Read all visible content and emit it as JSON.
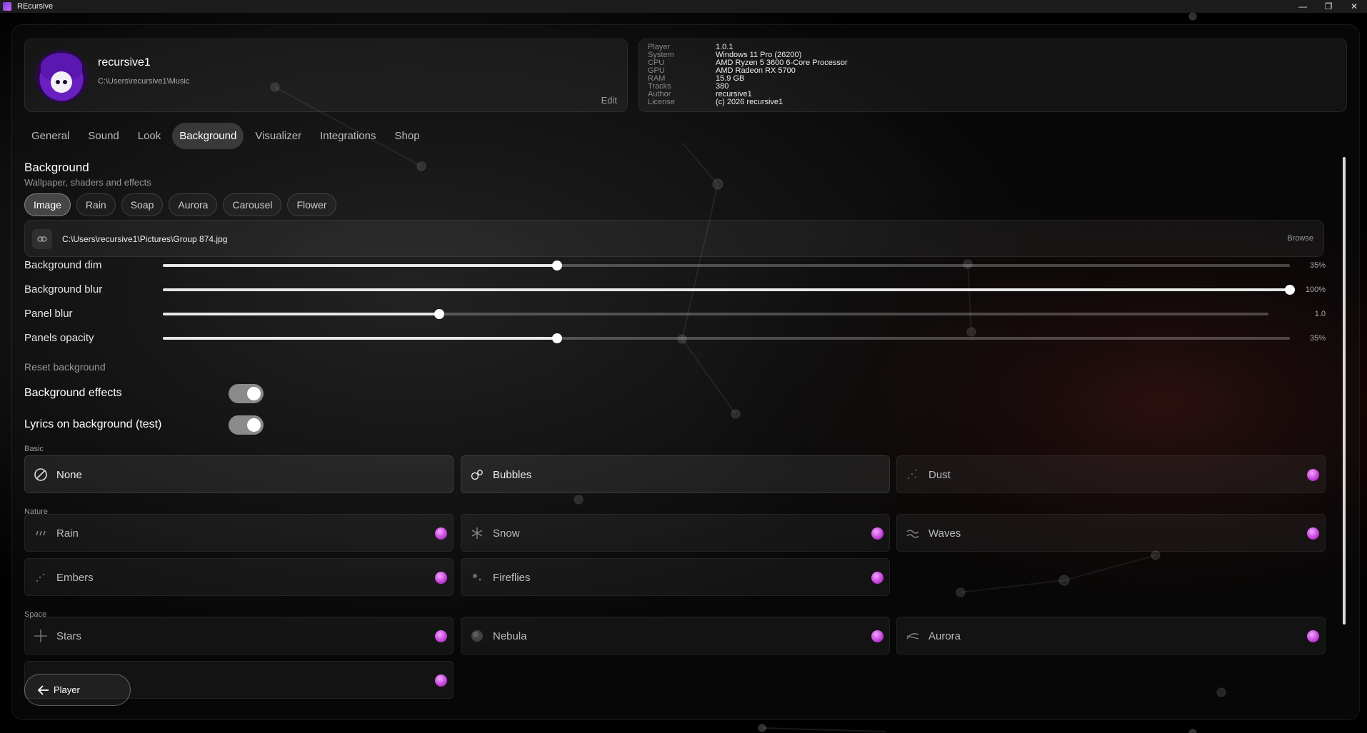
{
  "window": {
    "title": "REcursive",
    "minimize": "—",
    "restore": "❐",
    "close": "✕"
  },
  "profile": {
    "username": "recursive1",
    "music_path": "C:\\Users\\recursive1\\Music",
    "edit_label": "Edit"
  },
  "sysinfo": [
    {
      "key": "Player",
      "value": "1.0.1"
    },
    {
      "key": "System",
      "value": "Windows 11 Pro (26200)"
    },
    {
      "key": "CPU",
      "value": "AMD Ryzen 5 3600 6-Core Processor"
    },
    {
      "key": "GPU",
      "value": "AMD Radeon RX 5700"
    },
    {
      "key": "RAM",
      "value": "15.9 GB"
    },
    {
      "key": "Tracks",
      "value": "380"
    },
    {
      "key": "Author",
      "value": "recursive1"
    },
    {
      "key": "License",
      "value": "(c) 2026 recursive1"
    }
  ],
  "tabs": [
    {
      "label": "General",
      "active": false
    },
    {
      "label": "Sound",
      "active": false
    },
    {
      "label": "Look",
      "active": false
    },
    {
      "label": "Background",
      "active": true
    },
    {
      "label": "Visualizer",
      "active": false
    },
    {
      "label": "Integrations",
      "active": false
    },
    {
      "label": "Shop",
      "active": false
    }
  ],
  "section": {
    "title": "Background",
    "subtitle": "Wallpaper, shaders and effects"
  },
  "bg_types": [
    {
      "label": "Image",
      "active": true
    },
    {
      "label": "Rain",
      "active": false
    },
    {
      "label": "Soap",
      "active": false
    },
    {
      "label": "Aurora",
      "active": false
    },
    {
      "label": "Carousel",
      "active": false
    },
    {
      "label": "Flower",
      "active": false
    }
  ],
  "image_path": {
    "value": "C:\\Users\\recursive1\\Pictures\\Group 874.jpg",
    "browse_label": "Browse",
    "icon": "link-icon"
  },
  "sliders": [
    {
      "id": "background-dim",
      "label": "Background dim",
      "value_text": "35%",
      "fraction": 0.35
    },
    {
      "id": "background-blur",
      "label": "Background blur",
      "value_text": "100%",
      "fraction": 1.0
    },
    {
      "id": "panel-blur",
      "label": "Panel blur",
      "value_text": "1.0",
      "fraction": 0.25
    },
    {
      "id": "panels-opacity",
      "label": "Panels opacity",
      "value_text": "35%",
      "fraction": 0.35
    }
  ],
  "reset_label": "Reset background",
  "toggles": [
    {
      "id": "background-effects",
      "label": "Background effects",
      "on": true
    },
    {
      "id": "lyrics-on-background",
      "label": "Lyrics on background (test)",
      "on": true
    }
  ],
  "effect_groups": [
    {
      "label": "Basic",
      "items": [
        {
          "name": "None",
          "icon": "ban-icon",
          "premium": false,
          "selected": true
        },
        {
          "name": "Bubbles",
          "icon": "bubbles-icon",
          "premium": false,
          "selected": true
        },
        {
          "name": "Dust",
          "icon": "dust-icon",
          "premium": true,
          "selected": false
        }
      ]
    },
    {
      "label": "Nature",
      "items": [
        {
          "name": "Rain",
          "icon": "rain-icon",
          "premium": true,
          "selected": false
        },
        {
          "name": "Snow",
          "icon": "snowflake-icon",
          "premium": true,
          "selected": false
        },
        {
          "name": "Waves",
          "icon": "waves-icon",
          "premium": true,
          "selected": false
        },
        {
          "name": "Embers",
          "icon": "embers-icon",
          "premium": true,
          "selected": false
        },
        {
          "name": "Fireflies",
          "icon": "fireflies-icon",
          "premium": true,
          "selected": false
        }
      ]
    },
    {
      "label": "Space",
      "items": [
        {
          "name": "Stars",
          "icon": "star-icon",
          "premium": true,
          "selected": false
        },
        {
          "name": "Nebula",
          "icon": "nebula-icon",
          "premium": true,
          "selected": false
        },
        {
          "name": "Aurora",
          "icon": "aurora-icon",
          "premium": true,
          "selected": false
        },
        {
          "name": "",
          "icon": "",
          "premium": true,
          "selected": false
        }
      ]
    }
  ],
  "player_button": {
    "label": "Player",
    "icon": "arrow-left-icon"
  },
  "colors": {
    "accent": "#c33ed8",
    "toggle_on": "#8a8a8a"
  }
}
